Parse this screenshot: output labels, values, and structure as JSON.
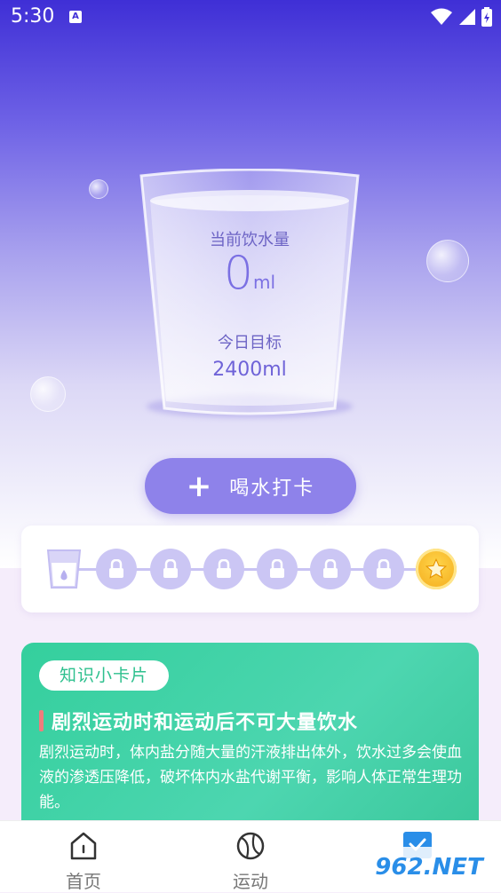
{
  "status_bar": {
    "time": "5:30",
    "notif_letter": "A"
  },
  "hero": {
    "current_label": "当前饮水量",
    "current_value": "0",
    "current_unit": "ml",
    "goal_label": "今日目标",
    "goal_value": "2400ml",
    "checkin_label": "喝水打卡"
  },
  "progress": {
    "steps": [
      {
        "type": "cup",
        "state": "current"
      },
      {
        "type": "lock",
        "state": "locked"
      },
      {
        "type": "lock",
        "state": "locked"
      },
      {
        "type": "lock",
        "state": "locked"
      },
      {
        "type": "lock",
        "state": "locked"
      },
      {
        "type": "lock",
        "state": "locked"
      },
      {
        "type": "lock",
        "state": "locked"
      },
      {
        "type": "star",
        "state": "reward"
      }
    ]
  },
  "knowledge": {
    "tag": "知识小卡片",
    "title": "剧烈运动时和运动后不可大量饮水",
    "body": "剧烈运动时，体内盐分随大量的汗液排出体外，饮水过多会使血液的渗透压降低，破坏体内水盐代谢平衡，影响人体正常生理功能。"
  },
  "tabbar": {
    "tabs": [
      {
        "label": "首页",
        "icon": "home-icon"
      },
      {
        "label": "运动",
        "icon": "sport-ball-icon"
      },
      {
        "label": "",
        "icon": "checkin-icon"
      }
    ]
  },
  "watermark": "962.NET",
  "colors": {
    "accent": "#8e82ea",
    "knowledge": "#34cf9d"
  }
}
